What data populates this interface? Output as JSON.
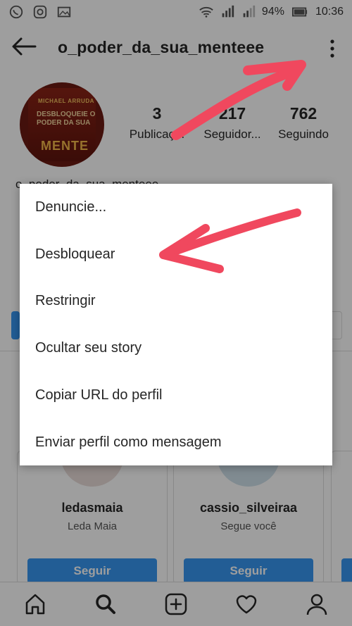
{
  "statusbar": {
    "battery": "94%",
    "time": "10:36",
    "left_icons": [
      "whatsapp-icon",
      "instagram-icon",
      "gallery-icon"
    ],
    "right_icons": [
      "wifi-icon",
      "signal-1-icon",
      "signal-2-icon",
      "battery-icon"
    ]
  },
  "header": {
    "username": "o_poder_da_sua_menteee"
  },
  "profile": {
    "book_author": "MICHAEL ARRUDA",
    "book_title": "Desbloqueie o poder da sua",
    "book_big": "MENTE",
    "stats": [
      {
        "number": "3",
        "label": "Publicaç..."
      },
      {
        "number": "217",
        "label": "Seguidor..."
      },
      {
        "number": "762",
        "label": "Seguindo"
      }
    ],
    "bio_name": "o_poder_da_sua_menteee"
  },
  "menu": {
    "items": [
      "Denuncie...",
      "Desbloquear",
      "Restringir",
      "Ocultar seu story",
      "Copiar URL do perfil",
      "Enviar perfil como mensagem"
    ]
  },
  "suggestions": [
    {
      "username": "ledasmaia",
      "subtitle": "Leda Maia",
      "button": "Seguir"
    },
    {
      "username": "cassio_silveiraa",
      "subtitle": "Segue você",
      "button": "Seguir"
    }
  ],
  "nav": {
    "items": [
      "home-icon",
      "search-icon",
      "add-post-icon",
      "activity-heart-icon",
      "profile-icon"
    ]
  },
  "colors": {
    "accent": "#3897f0",
    "annotation_arrow": "#f0485e",
    "overlay": "rgba(0,0,0,0.38)"
  }
}
